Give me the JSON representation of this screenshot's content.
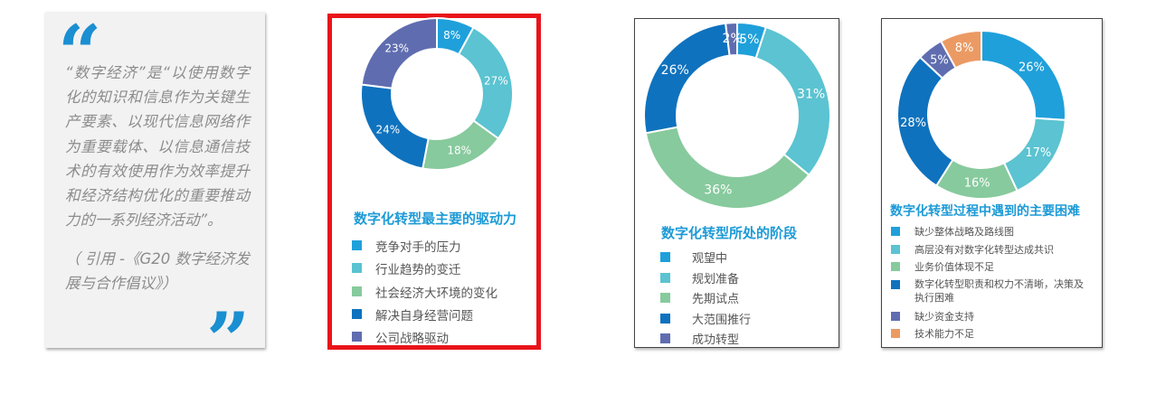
{
  "quote": {
    "open_mark": "“",
    "close_mark": "”",
    "text": "“数字经济”是“以使用数字化的知识和信息作为关键生产要素、以现代信息网络作为重要载体、以信息通信技术的有效使用作为效率提升和经济结构优化的重要推动力的一系列经济活动”。",
    "citation": "（ 引用 -《G20 数字经济发展与合作倡议》）"
  },
  "chart_data": [
    {
      "type": "pie",
      "donut": true,
      "title": "数字化转型最主要的驱动力",
      "categories": [
        "竞争对手的压力",
        "行业趋势的变迁",
        "社会经济大环境的变化",
        "解决自身经营问题",
        "公司战略驱动"
      ],
      "values": [
        8,
        27,
        18,
        24,
        23
      ],
      "labels": [
        "8%",
        "27%",
        "18%",
        "24%",
        "23%"
      ],
      "colors": [
        "#1fa0db",
        "#5bc3d1",
        "#87ca9d",
        "#0f72be",
        "#5f6db0"
      ],
      "highlighted": true
    },
    {
      "type": "pie",
      "donut": true,
      "title": "数字化转型所处的阶段",
      "categories": [
        "观望中",
        "规划准备",
        "先期试点",
        "大范围推行",
        "成功转型"
      ],
      "values": [
        5,
        31,
        36,
        26,
        2
      ],
      "labels": [
        "5%",
        "31%",
        "36%",
        "26%",
        "2%"
      ],
      "colors": [
        "#1fa0db",
        "#5bc3d1",
        "#87ca9d",
        "#0f72be",
        "#5f6db0"
      ]
    },
    {
      "type": "pie",
      "donut": true,
      "title": "数字化转型过程中遇到的主要困难",
      "categories": [
        "缺少整体战略及路线图",
        "高层没有对数字化转型达成共识",
        "业务价值体现不足",
        "数字化转型职责和权力不清晰，决策及执行困难",
        "缺少资金支持",
        "技术能力不足"
      ],
      "values": [
        26,
        17,
        16,
        28,
        5,
        8
      ],
      "labels": [
        "26%",
        "17%",
        "16%",
        "28%",
        "5%",
        "8%"
      ],
      "colors": [
        "#1fa0db",
        "#5bc3d1",
        "#87ca9d",
        "#0f72be",
        "#5f6db0",
        "#ec9a63"
      ]
    }
  ]
}
